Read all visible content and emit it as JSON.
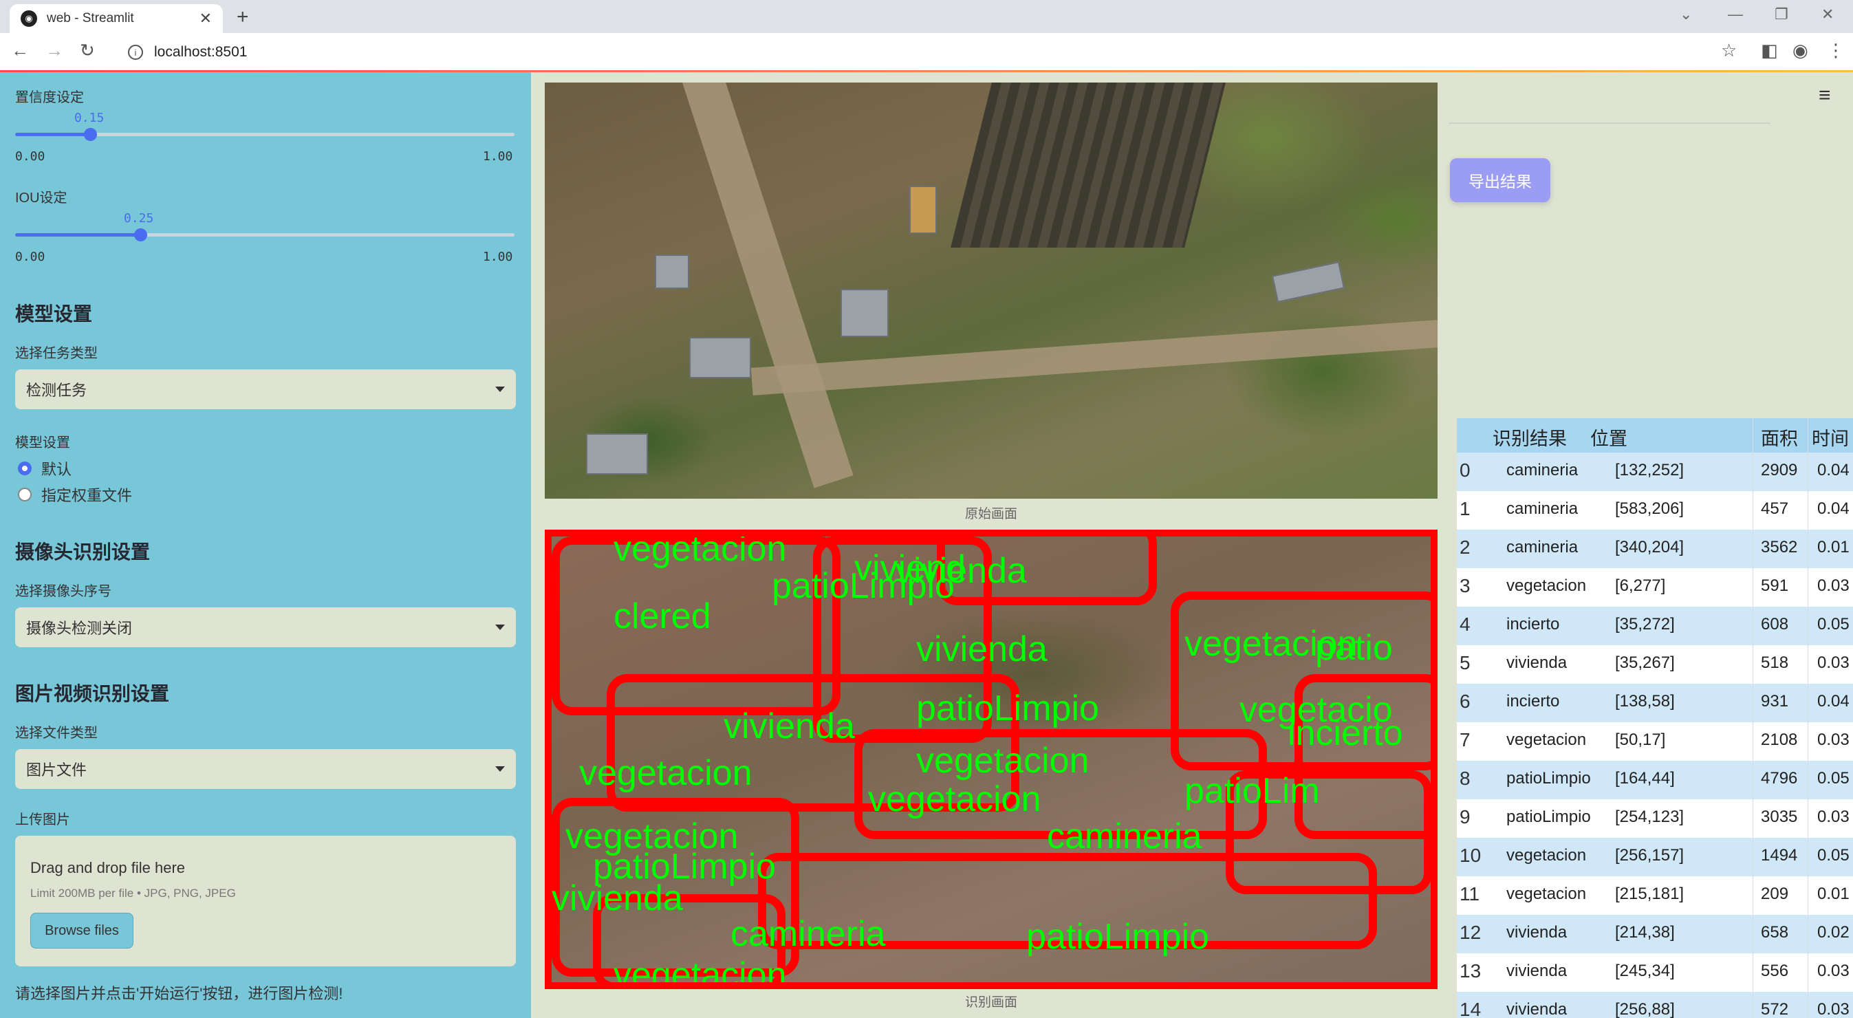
{
  "browser": {
    "tab_title": "web - Streamlit",
    "url": "localhost:8501"
  },
  "sidebar": {
    "confidence": {
      "label": "置信度设定",
      "value": "0.15",
      "min": "0.00",
      "max": "1.00",
      "level": 0.15
    },
    "iou": {
      "label": "IOU设定",
      "value": "0.25",
      "min": "0.00",
      "max": "1.00",
      "level": 0.25
    },
    "model_section": "模型设置",
    "task_type_label": "选择任务类型",
    "task_type_value": "检测任务",
    "model_settings_label": "模型设置",
    "radio_options": [
      {
        "label": "默认",
        "selected": true
      },
      {
        "label": "指定权重文件",
        "selected": false
      }
    ],
    "camera_section": "摄像头识别设置",
    "camera_label": "选择摄像头序号",
    "camera_value": "摄像头检测关闭",
    "media_section": "图片视频识别设置",
    "file_type_label": "选择文件类型",
    "file_type_value": "图片文件",
    "upload_label": "上传图片",
    "upload_title": "Drag and drop file here",
    "upload_hint": "Limit 200MB per file • JPG, PNG, JPEG",
    "browse_label": "Browse files",
    "footer_text": "请选择图片并点击'开始运行'按钮，进行图片检测!"
  },
  "main": {
    "original_caption": "原始画面",
    "result_caption": "识别画面",
    "detection_labels": [
      "vegetacion",
      "viviend",
      "patioLimpio",
      "vivienda",
      "clered",
      "vivienda",
      "vegetacion",
      "patio",
      "patioLimpio",
      "vegetacio",
      "vivienda",
      "vegetacion",
      "vegetacion",
      "patioLim",
      "vegetacion",
      "camineria",
      "vegetacion",
      "patioLimpio",
      "vivienda",
      "camineria",
      "patioLimpio",
      "vegetacion",
      "incierto"
    ]
  },
  "right": {
    "export_label": "导出结果",
    "table": {
      "headers": [
        "识别结果",
        "位置",
        "面积",
        "时间"
      ],
      "rows": [
        [
          "0",
          "camineria",
          "[132,252]",
          "2909",
          "0.04"
        ],
        [
          "1",
          "camineria",
          "[583,206]",
          "457",
          "0.04"
        ],
        [
          "2",
          "camineria",
          "[340,204]",
          "3562",
          "0.01"
        ],
        [
          "3",
          "vegetacion",
          "[6,277]",
          "591",
          "0.03"
        ],
        [
          "4",
          "incierto",
          "[35,272]",
          "608",
          "0.05"
        ],
        [
          "5",
          "vivienda",
          "[35,267]",
          "518",
          "0.03"
        ],
        [
          "6",
          "incierto",
          "[138,58]",
          "931",
          "0.04"
        ],
        [
          "7",
          "vegetacion",
          "[50,17]",
          "2108",
          "0.03"
        ],
        [
          "8",
          "patioLimpio",
          "[164,44]",
          "4796",
          "0.05"
        ],
        [
          "9",
          "patioLimpio",
          "[254,123]",
          "3035",
          "0.03"
        ],
        [
          "10",
          "vegetacion",
          "[256,157]",
          "1494",
          "0.05"
        ],
        [
          "11",
          "vegetacion",
          "[215,181]",
          "209",
          "0.01"
        ],
        [
          "12",
          "vivienda",
          "[214,38]",
          "658",
          "0.02"
        ],
        [
          "13",
          "vivienda",
          "[245,34]",
          "556",
          "0.03"
        ],
        [
          "14",
          "vivienda",
          "[256,88]",
          "572",
          "0.03"
        ]
      ]
    }
  }
}
